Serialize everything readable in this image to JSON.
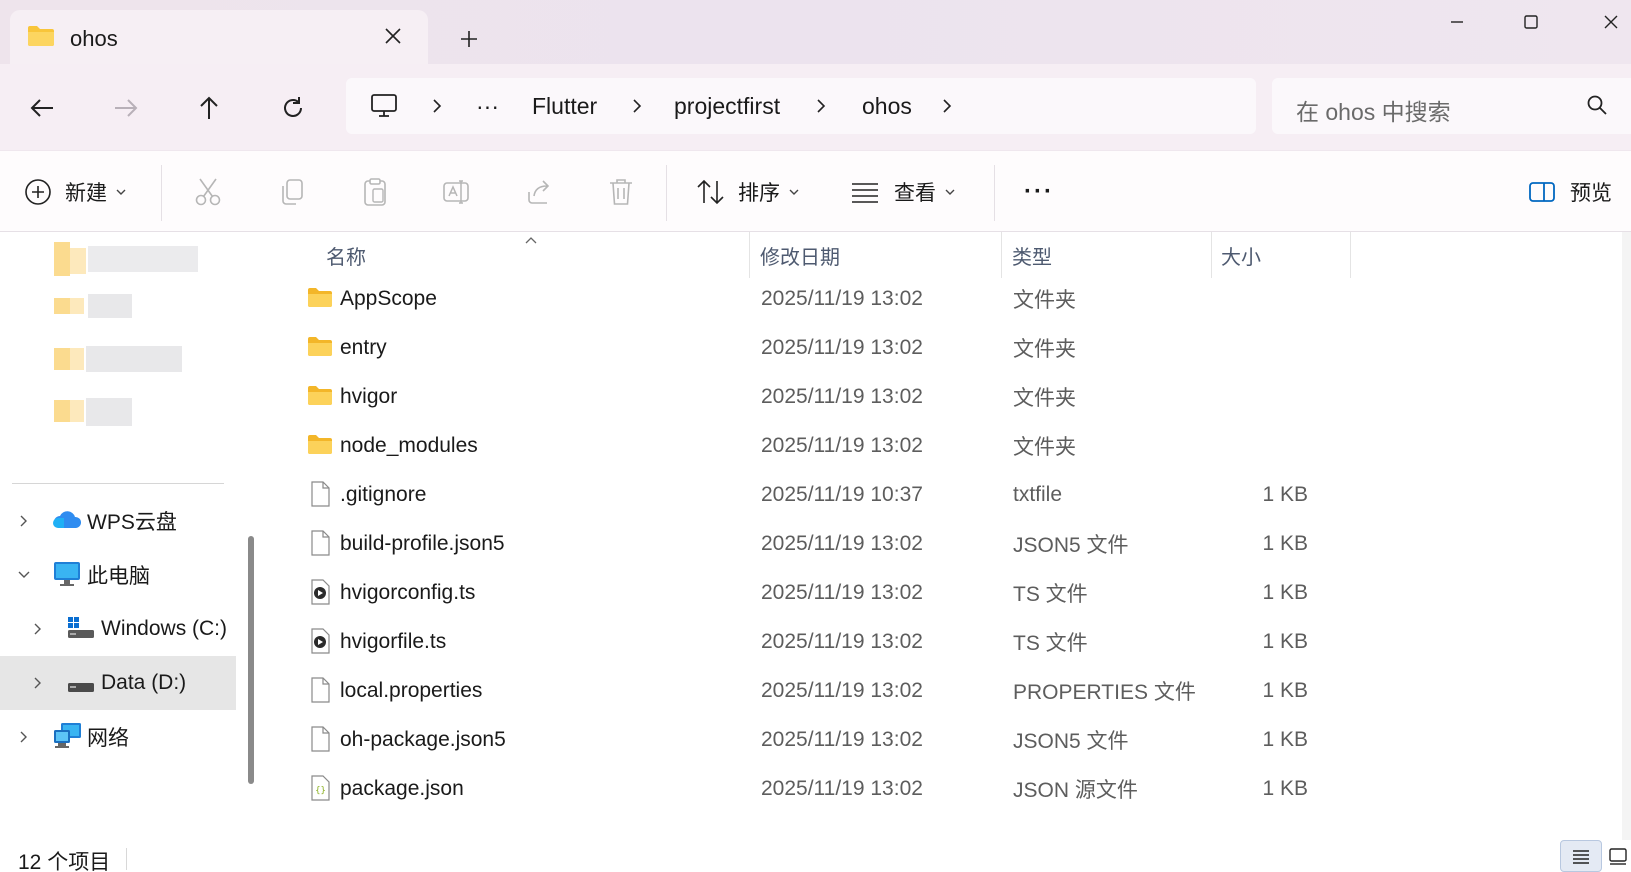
{
  "tab": {
    "title": "ohos",
    "new_tab_symbol": "+"
  },
  "window_controls": [
    "minimize-icon",
    "maximize-icon",
    "close-icon"
  ],
  "breadcrumb": {
    "more": "···",
    "items": [
      "Flutter",
      "projectfirst",
      "ohos"
    ]
  },
  "search": {
    "placeholder": "在 ohos 中搜索"
  },
  "commandbar": {
    "new_label": "新建",
    "sort_label": "排序",
    "view_label": "查看",
    "more_label": "···",
    "preview_label": "预览"
  },
  "sidebar": {
    "wps_label": "WPS云盘",
    "pc_label": "此电脑",
    "drive_c_label": "Windows (C:)",
    "drive_d_label": "Data (D:)",
    "network_label": "网络"
  },
  "columns": {
    "name": "名称",
    "date": "修改日期",
    "type": "类型",
    "size": "大小"
  },
  "files": [
    {
      "name": "AppScope",
      "date": "2025/11/19 13:02",
      "type": "文件夹",
      "size": "",
      "icon": "folder-icon"
    },
    {
      "name": "entry",
      "date": "2025/11/19 13:02",
      "type": "文件夹",
      "size": "",
      "icon": "folder-icon"
    },
    {
      "name": "hvigor",
      "date": "2025/11/19 13:02",
      "type": "文件夹",
      "size": "",
      "icon": "folder-icon"
    },
    {
      "name": "node_modules",
      "date": "2025/11/19 13:02",
      "type": "文件夹",
      "size": "",
      "icon": "folder-icon"
    },
    {
      "name": ".gitignore",
      "date": "2025/11/19 10:37",
      "type": "txtfile",
      "size": "1 KB",
      "icon": "file-icon"
    },
    {
      "name": "build-profile.json5",
      "date": "2025/11/19 13:02",
      "type": "JSON5 文件",
      "size": "1 KB",
      "icon": "file-icon"
    },
    {
      "name": "hvigorconfig.ts",
      "date": "2025/11/19 13:02",
      "type": "TS 文件",
      "size": "1 KB",
      "icon": "media-file-icon"
    },
    {
      "name": "hvigorfile.ts",
      "date": "2025/11/19 13:02",
      "type": "TS 文件",
      "size": "1 KB",
      "icon": "media-file-icon"
    },
    {
      "name": "local.properties",
      "date": "2025/11/19 13:02",
      "type": "PROPERTIES 文件",
      "size": "1 KB",
      "icon": "file-icon"
    },
    {
      "name": "oh-package.json5",
      "date": "2025/11/19 13:02",
      "type": "JSON5 文件",
      "size": "1 KB",
      "icon": "file-icon"
    },
    {
      "name": "package.json",
      "date": "2025/11/19 13:02",
      "type": "JSON 源文件",
      "size": "1 KB",
      "icon": "json-file-icon"
    }
  ],
  "status": {
    "item_count": "12 个项目"
  },
  "colors": {
    "folder": "#f8c53a",
    "accent": "#0067c0",
    "titlebar": "#eee4ec"
  }
}
